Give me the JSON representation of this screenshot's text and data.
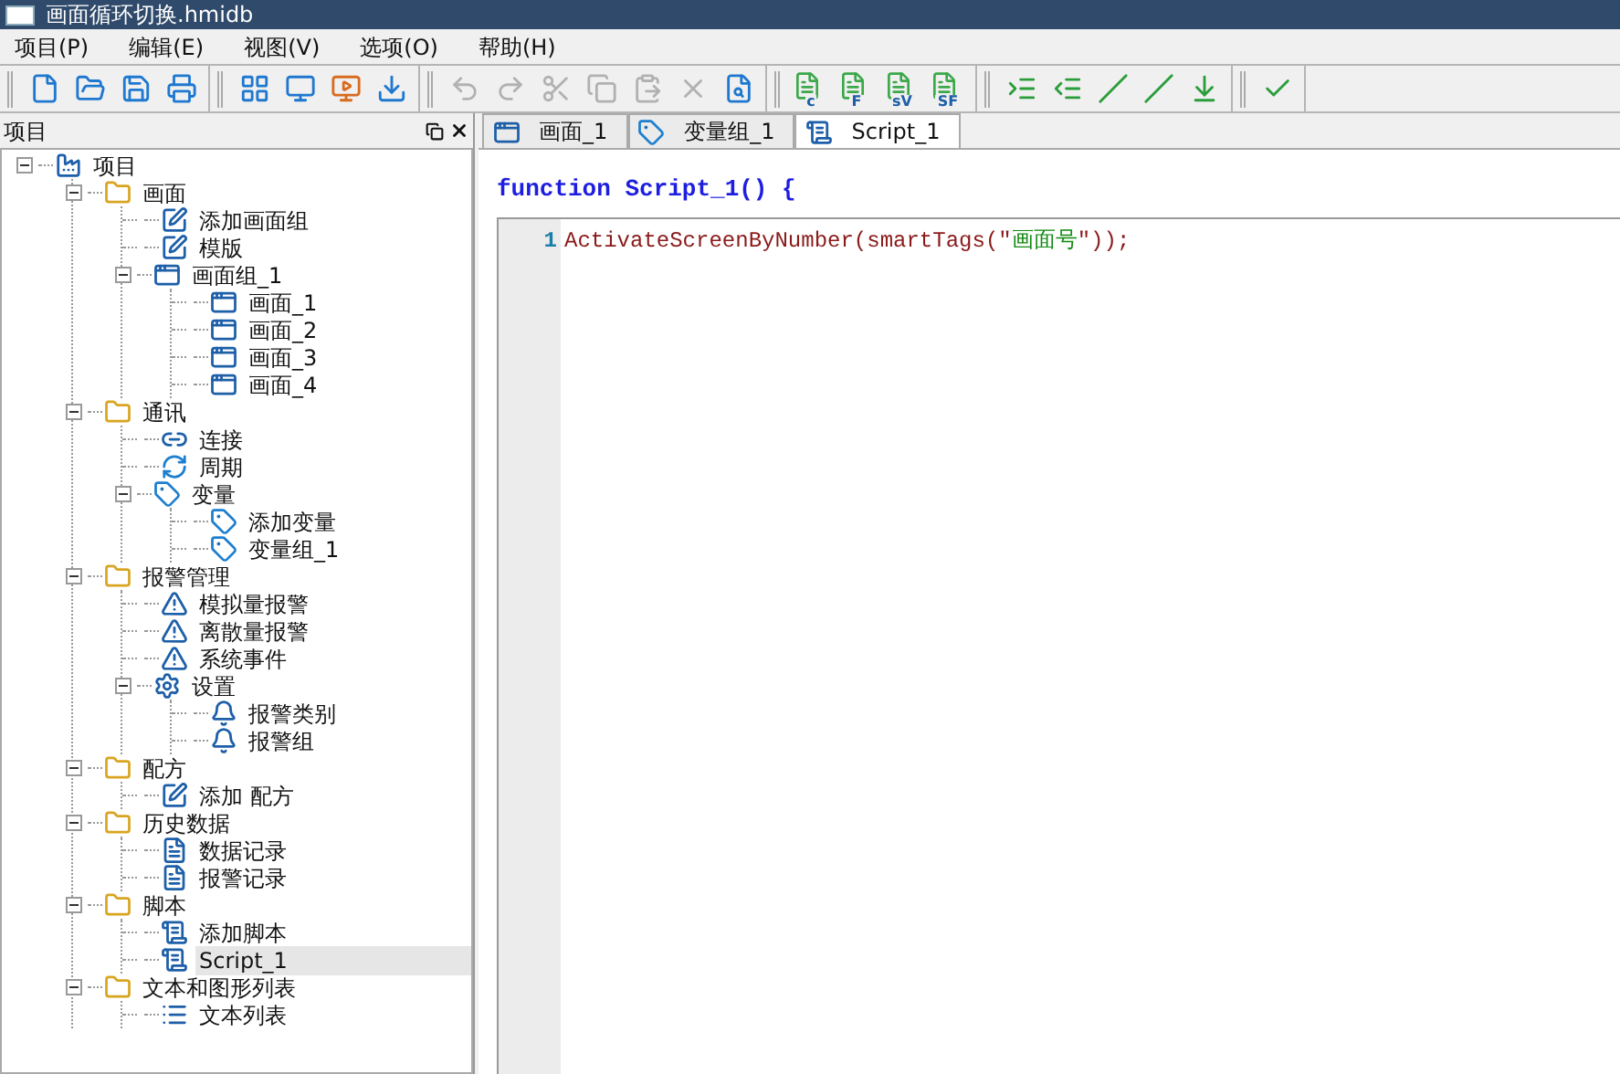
{
  "window": {
    "title": "画面循环切换.hmidb"
  },
  "menu": [
    "项目(P)",
    "编辑(E)",
    "视图(V)",
    "选项(O)",
    "帮助(H)"
  ],
  "toolbar": [
    [
      {
        "kind": "new",
        "disabled": false
      },
      {
        "kind": "open",
        "disabled": false
      },
      {
        "kind": "save",
        "disabled": false
      },
      {
        "kind": "print",
        "disabled": false
      }
    ],
    [
      {
        "kind": "grid",
        "disabled": false
      },
      {
        "kind": "monitor",
        "disabled": false
      },
      {
        "kind": "monitor-play",
        "disabled": false
      },
      {
        "kind": "download",
        "disabled": false
      }
    ],
    [
      {
        "kind": "undo",
        "disabled": true
      },
      {
        "kind": "redo",
        "disabled": true
      },
      {
        "kind": "cut",
        "disabled": true
      },
      {
        "kind": "copy",
        "disabled": true
      },
      {
        "kind": "paste",
        "disabled": true
      },
      {
        "kind": "delete",
        "disabled": true
      },
      {
        "kind": "find",
        "disabled": false
      }
    ],
    [
      {
        "kind": "doc-letter",
        "letter": "c",
        "disabled": false
      },
      {
        "kind": "doc-letter",
        "letter": "F",
        "disabled": false
      },
      {
        "kind": "doc-letter",
        "letter": "sV",
        "disabled": false
      },
      {
        "kind": "doc-letter",
        "letter": "SF",
        "disabled": false
      }
    ],
    [
      {
        "kind": "indent",
        "disabled": false
      },
      {
        "kind": "outdent",
        "disabled": false
      },
      {
        "kind": "comment",
        "disabled": false
      },
      {
        "kind": "uncomment",
        "disabled": false
      },
      {
        "kind": "down",
        "disabled": false
      }
    ],
    [
      {
        "kind": "check",
        "disabled": false
      }
    ]
  ],
  "project_panel": {
    "title": "项目",
    "tree": [
      {
        "label": "项目",
        "kind": "factory",
        "expanded": true,
        "selected": false,
        "children": [
          {
            "label": "画面",
            "kind": "folder",
            "expanded": true,
            "selected": false,
            "children": [
              {
                "label": "添加画面组",
                "kind": "edit",
                "selected": false
              },
              {
                "label": "模版",
                "kind": "edit",
                "selected": false
              },
              {
                "label": "画面组_1",
                "kind": "screen",
                "expanded": true,
                "selected": false,
                "children": [
                  {
                    "label": "画面_1",
                    "kind": "screen",
                    "selected": false
                  },
                  {
                    "label": "画面_2",
                    "kind": "screen",
                    "selected": false
                  },
                  {
                    "label": "画面_3",
                    "kind": "screen",
                    "selected": false
                  },
                  {
                    "label": "画面_4",
                    "kind": "screen",
                    "selected": false
                  }
                ]
              }
            ]
          },
          {
            "label": "通讯",
            "kind": "folder",
            "expanded": true,
            "selected": false,
            "children": [
              {
                "label": "连接",
                "kind": "connection",
                "selected": false
              },
              {
                "label": "周期",
                "kind": "cycle",
                "selected": false
              },
              {
                "label": "变量",
                "kind": "tag",
                "expanded": true,
                "selected": false,
                "children": [
                  {
                    "label": "添加变量",
                    "kind": "tag",
                    "selected": false
                  },
                  {
                    "label": "变量组_1",
                    "kind": "tag",
                    "selected": false
                  }
                ]
              }
            ]
          },
          {
            "label": "报警管理",
            "kind": "folder",
            "expanded": true,
            "selected": false,
            "children": [
              {
                "label": "模拟量报警",
                "kind": "alarm",
                "selected": false
              },
              {
                "label": "离散量报警",
                "kind": "alarm",
                "selected": false
              },
              {
                "label": "系统事件",
                "kind": "alarm",
                "selected": false
              },
              {
                "label": "设置",
                "kind": "settings",
                "expanded": true,
                "selected": false,
                "children": [
                  {
                    "label": "报警类别",
                    "kind": "alarm-group",
                    "selected": false
                  },
                  {
                    "label": "报警组",
                    "kind": "alarm-group",
                    "selected": false
                  }
                ]
              }
            ]
          },
          {
            "label": "配方",
            "kind": "folder",
            "expanded": true,
            "selected": false,
            "children": [
              {
                "label": "添加 配方",
                "kind": "edit",
                "selected": false
              }
            ]
          },
          {
            "label": "历史数据",
            "kind": "folder",
            "expanded": true,
            "selected": false,
            "children": [
              {
                "label": "数据记录",
                "kind": "doc",
                "selected": false
              },
              {
                "label": "报警记录",
                "kind": "doc",
                "selected": false
              }
            ]
          },
          {
            "label": "脚本",
            "kind": "folder",
            "expanded": true,
            "selected": false,
            "children": [
              {
                "label": "添加脚本",
                "kind": "script",
                "selected": false
              },
              {
                "label": "Script_1",
                "kind": "script",
                "selected": true
              }
            ]
          },
          {
            "label": "文本和图形列表",
            "kind": "folder",
            "expanded": true,
            "selected": false,
            "children": [
              {
                "label": "文本列表",
                "kind": "list",
                "selected": false
              }
            ]
          }
        ]
      }
    ]
  },
  "tabs": [
    {
      "label": "画面_1",
      "kind": "screen",
      "selected": false
    },
    {
      "label": "变量组_1",
      "kind": "tag",
      "selected": false
    },
    {
      "label": "Script_1",
      "kind": "script",
      "selected": true
    }
  ],
  "editor": {
    "header": "function Script_1() {",
    "lines": [
      {
        "number": "1",
        "segments": [
          {
            "kind": "code",
            "text": "ActivateScreenByNumber(smartTags(\""
          },
          {
            "kind": "string",
            "text": "画面号"
          },
          {
            "kind": "code",
            "text": "\"));"
          }
        ]
      }
    ]
  }
}
